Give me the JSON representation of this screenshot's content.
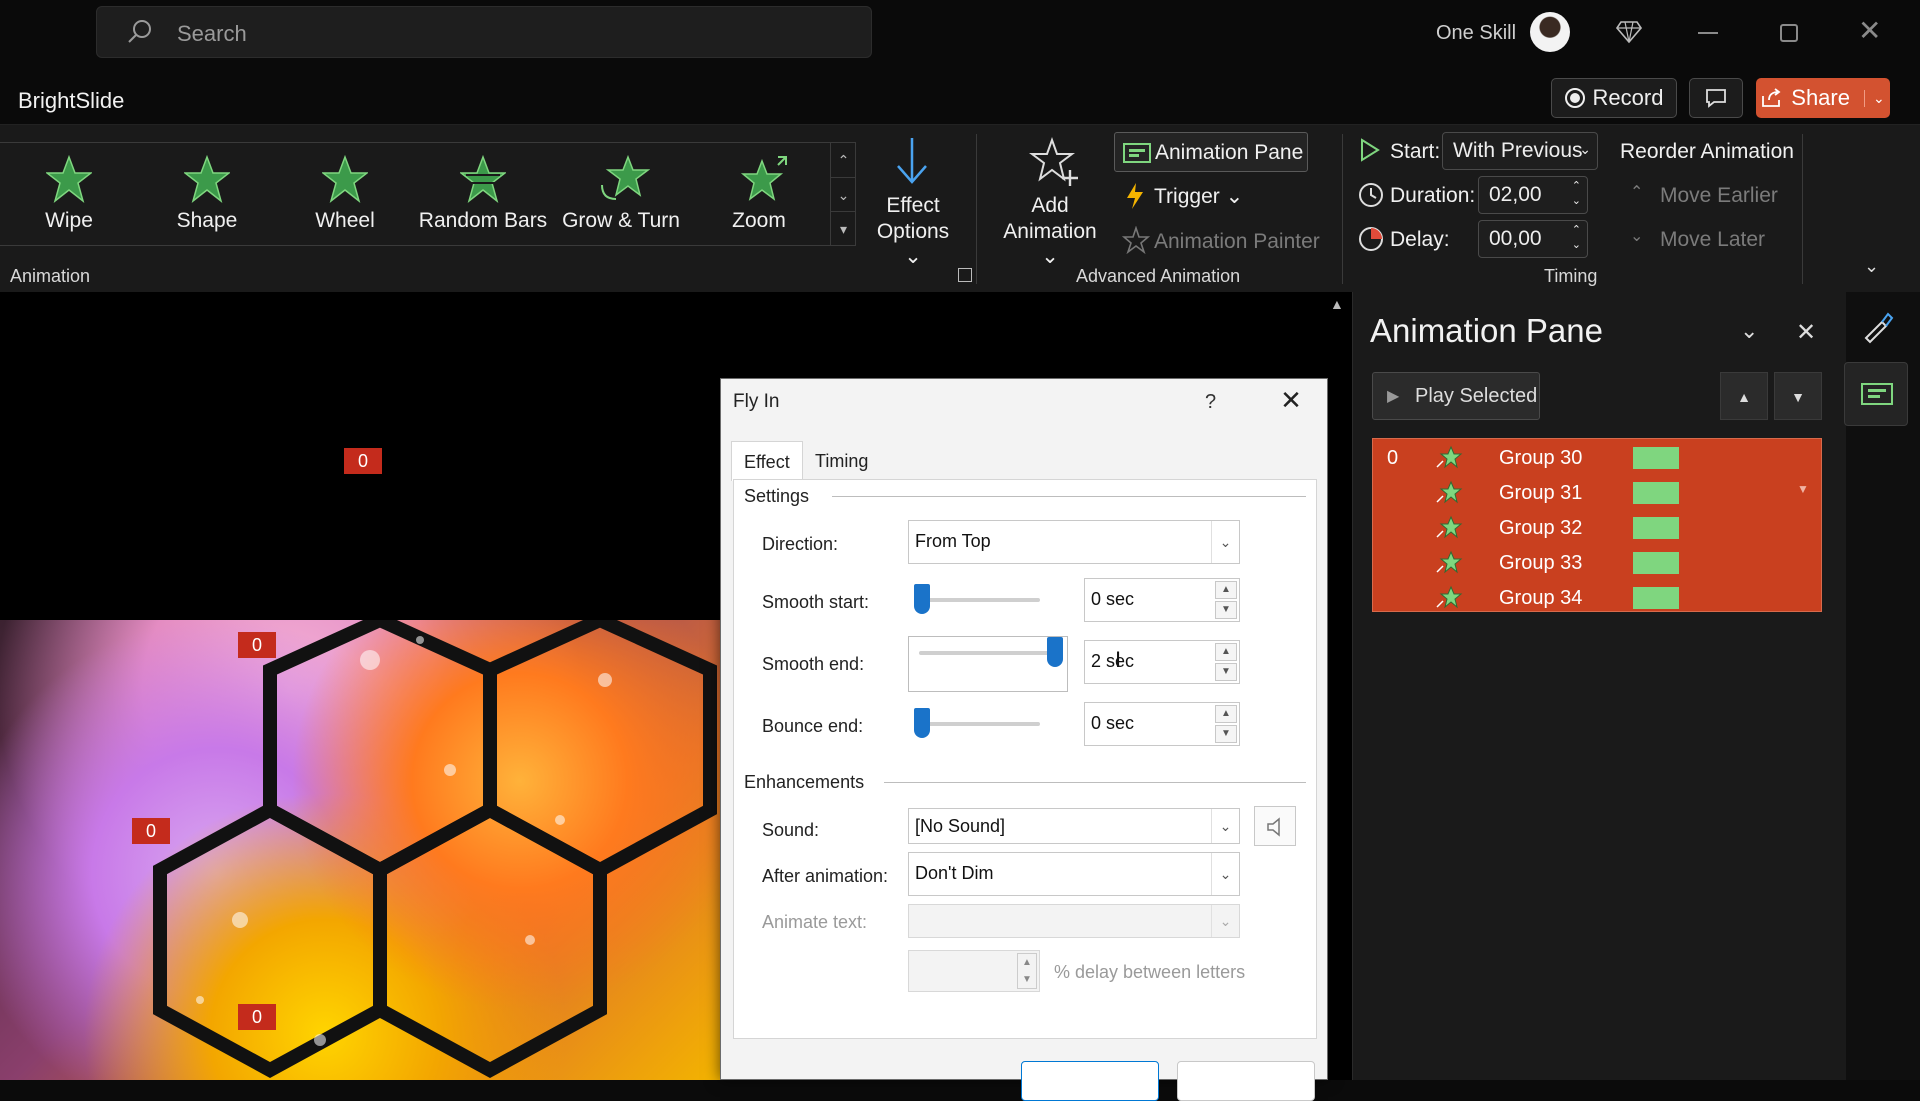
{
  "titlebar": {
    "search_placeholder": "Search",
    "account_name": "One Skill"
  },
  "app": {
    "name": "BrightSlide",
    "record_label": "Record",
    "share_label": "Share"
  },
  "ribbon": {
    "gallery": [
      {
        "label": "Wipe"
      },
      {
        "label": "Shape"
      },
      {
        "label": "Wheel"
      },
      {
        "label": "Random Bars"
      },
      {
        "label": "Grow & Turn"
      },
      {
        "label": "Zoom"
      }
    ],
    "effect_options": {
      "line1": "Effect",
      "line2": "Options ⌄"
    },
    "animation_group": "Animation",
    "add_animation": {
      "line1": "Add",
      "line2": "Animation ⌄"
    },
    "animation_pane_button": "Animation Pane",
    "trigger_label": "Trigger ⌄",
    "animation_painter": "Animation Painter",
    "advanced_group": "Advanced Animation",
    "start_label": "Start:",
    "start_value": "With Previous",
    "duration_label": "Duration:",
    "duration_value": "02,00",
    "delay_label": "Delay:",
    "delay_value": "00,00",
    "timing_group": "Timing",
    "reorder_label": "Reorder Animation",
    "move_earlier": "Move Earlier",
    "move_later": "Move Later"
  },
  "slide": {
    "tags": [
      "0",
      "0",
      "0",
      "0"
    ]
  },
  "dialog": {
    "title": "Fly In",
    "help": "?",
    "tabs": [
      "Effect",
      "Timing"
    ],
    "settings_header": "Settings",
    "direction_label": "Direction:",
    "direction_value": "From Top",
    "smooth_start_label": "Smooth start:",
    "smooth_start_value": "0 sec",
    "smooth_start_level": 0,
    "smooth_end_label": "Smooth end:",
    "smooth_end_value": "2 sec",
    "smooth_end_level": 1,
    "bounce_end_label": "Bounce end:",
    "bounce_end_value": "0 sec",
    "bounce_end_level": 0,
    "enhancements_header": "Enhancements",
    "sound_label": "Sound:",
    "sound_value": "[No Sound]",
    "after_animation_label": "After animation:",
    "after_animation_value": "Don't Dim",
    "animate_text_label": "Animate text:",
    "delay_letters_label": "% delay between letters"
  },
  "pane": {
    "title": "Animation Pane",
    "play_selected": "Play Selected",
    "items": [
      {
        "index": "0",
        "name": "Group 30"
      },
      {
        "index": "",
        "name": "Group 31"
      },
      {
        "index": "",
        "name": "Group 32"
      },
      {
        "index": "",
        "name": "Group 33"
      },
      {
        "index": "",
        "name": "Group 34"
      }
    ]
  },
  "colors": {
    "accent_orange": "#d35230",
    "selection_red": "#c9401f",
    "timeline_green": "#7fd67f",
    "star_green": "#3c9a4a",
    "slider_blue": "#1a73c9"
  }
}
